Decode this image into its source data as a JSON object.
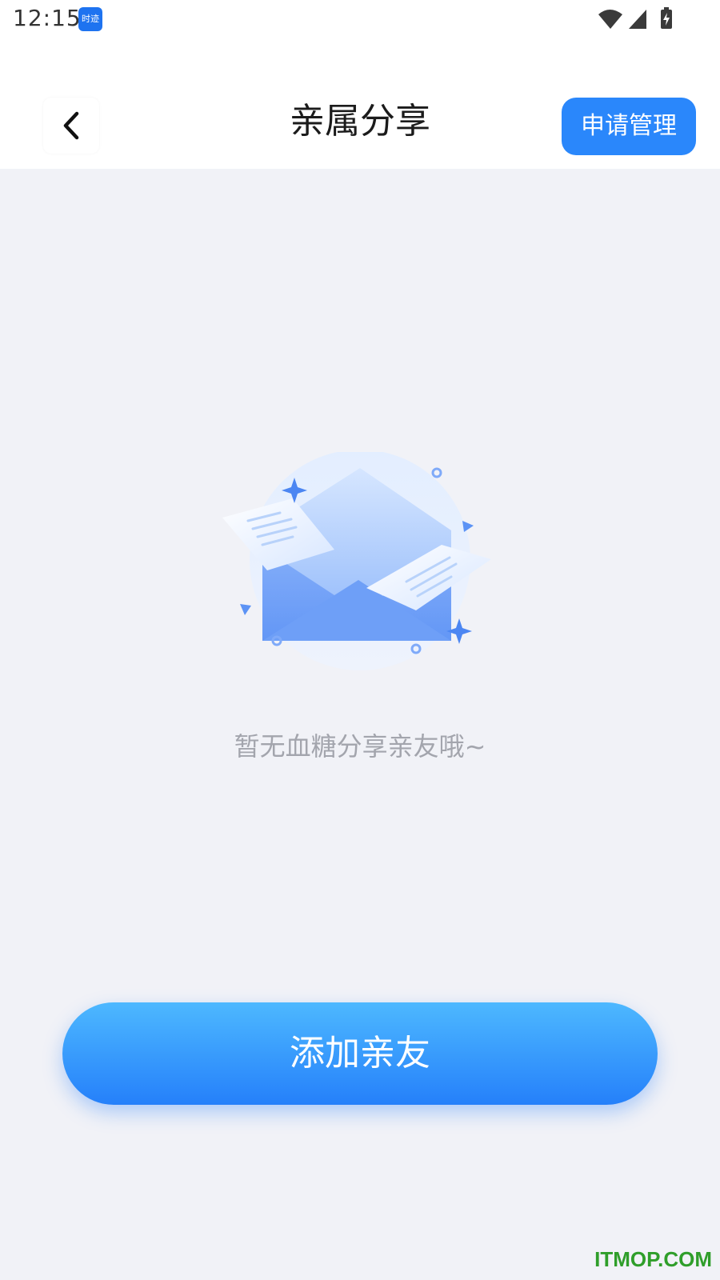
{
  "status_bar": {
    "time": "12:15",
    "app_badge": "时迹",
    "icons": [
      "wifi-icon",
      "cell-signal-icon",
      "battery-charging-icon"
    ]
  },
  "header": {
    "back_icon": "chevron-left-icon",
    "title": "亲属分享",
    "manage_label": "申请管理"
  },
  "empty_state": {
    "illustration": "envelope-with-letters-icon",
    "message": "暂无血糖分享亲友哦~"
  },
  "footer": {
    "add_label": "添加亲友"
  },
  "watermark": "ITMOP.COM",
  "colors": {
    "accent": "#2A87FB",
    "button_gradient_top": "#4DB8FF",
    "button_gradient_bottom": "#2580FA",
    "background": "#F1F2F7",
    "muted_text": "#A3A5AD"
  }
}
